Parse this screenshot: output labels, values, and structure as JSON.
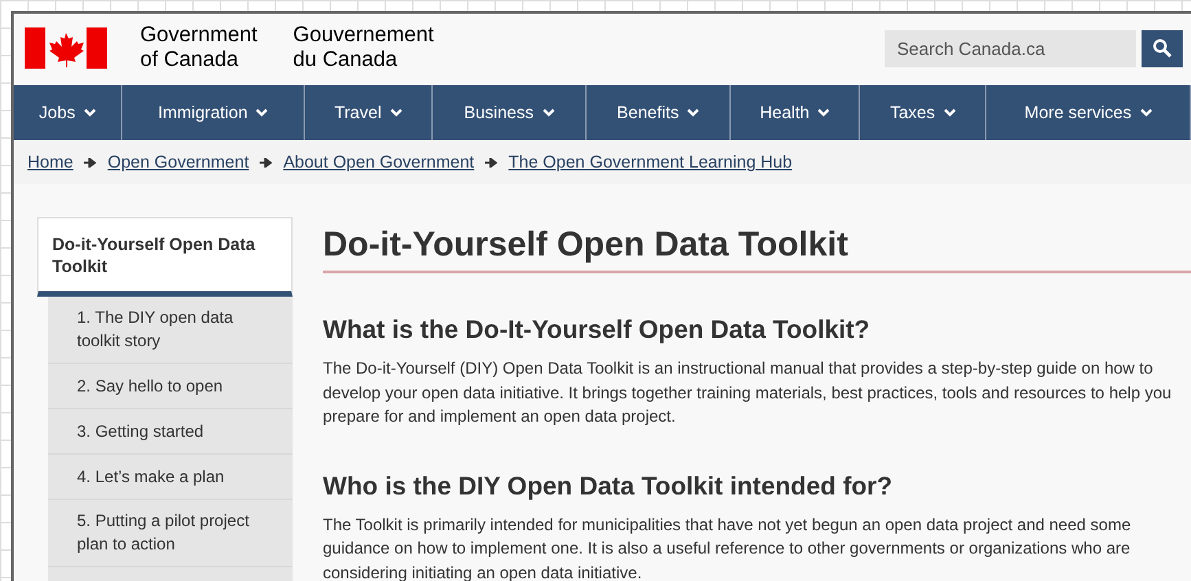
{
  "header": {
    "name_en": [
      "Government",
      "of Canada"
    ],
    "name_fr": [
      "Gouvernement",
      "du Canada"
    ],
    "search": {
      "placeholder": "Search Canada.ca"
    }
  },
  "nav": [
    "Jobs",
    "Immigration",
    "Travel",
    "Business",
    "Benefits",
    "Health",
    "Taxes",
    "More services"
  ],
  "breadcrumb": [
    "Home",
    "Open Government",
    "About Open Government",
    "The Open Government Learning Hub"
  ],
  "sidebar": {
    "title": "Do-it-Yourself Open Data Toolkit",
    "items": [
      {
        "label": "1. The DIY open data toolkit story"
      },
      {
        "label": "2. Say hello to open"
      },
      {
        "label": "3. Getting started"
      },
      {
        "label": "4. Let’s make a plan"
      },
      {
        "label": "5. Putting a pilot project plan to action"
      }
    ]
  },
  "main": {
    "title": "Do-it-Yourself Open Data Toolkit",
    "sections": [
      {
        "heading": "What is the Do-It-Yourself Open Data Toolkit?",
        "text": "The Do-it-Yourself (DIY) Open Data Toolkit is an instructional manual that provides a step-by-step guide on how to develop your open data initiative. It brings together training materials, best practices, tools and resources to help you prepare for and implement an open data project."
      },
      {
        "heading": "Who is the DIY Open Data Toolkit intended for?",
        "text": "The Toolkit is primarily intended for municipalities that have not yet begun an open data project and need some guidance on how to implement one. It is also a useful reference to other governments or organizations who are considering initiating an open data initiative."
      }
    ]
  }
}
